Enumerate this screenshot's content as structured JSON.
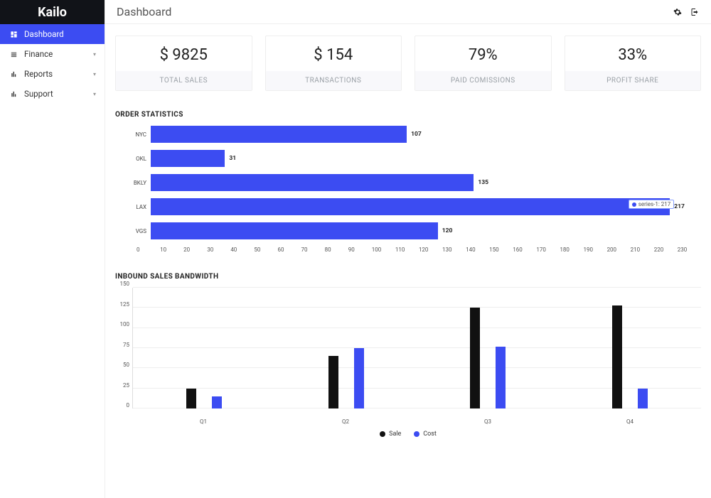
{
  "brand": "Kailo",
  "page_title": "Dashboard",
  "sidebar": {
    "items": [
      {
        "label": "Dashboard",
        "icon": "dashboard-icon",
        "active": true,
        "expandable": false
      },
      {
        "label": "Finance",
        "icon": "finance-icon",
        "active": false,
        "expandable": true
      },
      {
        "label": "Reports",
        "icon": "reports-icon",
        "active": false,
        "expandable": true
      },
      {
        "label": "Support",
        "icon": "support-icon",
        "active": false,
        "expandable": true
      }
    ]
  },
  "stats": [
    {
      "value": "$ 9825",
      "label": "TOTAL SALES"
    },
    {
      "value": "$ 154",
      "label": "TRANSACTIONS"
    },
    {
      "value": "79%",
      "label": "PAID COMISSIONS"
    },
    {
      "value": "33%",
      "label": "PROFIT SHARE"
    }
  ],
  "order_stats_title": "ORDER STATISTICS",
  "inbound_title": "INBOUND SALES BANDWIDTH",
  "legend": {
    "sale": "Sale",
    "cost": "Cost"
  },
  "tooltip": {
    "series": "series-1:",
    "val": "217"
  },
  "chart_data": [
    {
      "type": "bar",
      "orientation": "horizontal",
      "title": "ORDER STATISTICS",
      "categories": [
        "NYC",
        "OKL",
        "BKLY",
        "LAX",
        "VGS"
      ],
      "values": [
        107,
        31,
        135,
        217,
        120
      ],
      "xlabel": "",
      "ylabel": "",
      "xlim": [
        0,
        230
      ],
      "xticks": [
        0,
        10,
        20,
        30,
        40,
        50,
        60,
        70,
        80,
        90,
        100,
        110,
        120,
        130,
        140,
        150,
        160,
        170,
        180,
        190,
        200,
        210,
        220,
        230
      ]
    },
    {
      "type": "bar",
      "orientation": "vertical",
      "title": "INBOUND SALES BANDWIDTH",
      "categories": [
        "Q1",
        "Q2",
        "Q3",
        "Q4"
      ],
      "series": [
        {
          "name": "Sale",
          "values": [
            25,
            65,
            125,
            128
          ]
        },
        {
          "name": "Cost",
          "values": [
            15,
            75,
            77,
            25
          ]
        }
      ],
      "ylabel": "",
      "ylim": [
        0,
        150
      ],
      "yticks": [
        0,
        25,
        50,
        75,
        100,
        125,
        150
      ]
    }
  ]
}
